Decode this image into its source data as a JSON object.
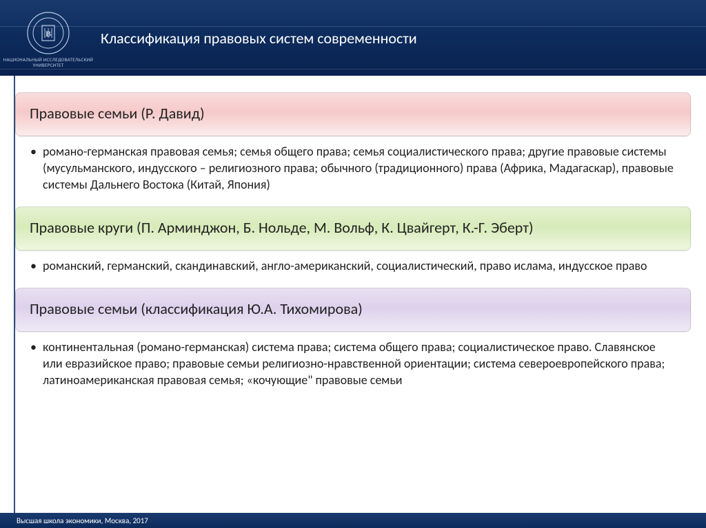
{
  "header": {
    "title": "Классификация правовых систем современности",
    "logo_line1": "НАЦИОНАЛЬНЫЙ ИССЛЕДОВАТЕЛЬСКИЙ",
    "logo_line2": "УНИВЕРСИТЕТ"
  },
  "blocks": [
    {
      "heading": "Правовые семьи (Р. Давид)",
      "body": "романо-германская правовая семья; семья общего права; семья социалистического права; другие правовые системы (мусульманского, индусского – религиозного права; обычного (традиционного) права (Африка, Мадагаскар), правовые системы Дальнего Востока (Китай, Япония)"
    },
    {
      "heading": "Правовые круги (П. Арминджон, Б. Нольде, М. Вольф, К. Цвайгерт, К.-Г. Эберт)",
      "body": "романский, германский, скандинавский, англо-американский, социалистический, право ислама, индусское право"
    },
    {
      "heading": "Правовые семьи (классификация Ю.А. Тихомирова)",
      "body": "континентальная (романо-германская) система права; система общего права; социалистическое право. Славянское или евразийское право; правовые семьи религиозно-нравственной ориентации; система североевропейского права; латиноамериканская правовая семья; «кочующие\" правовые семьи"
    }
  ],
  "footer": "Высшая школа экономики, Москва, 2017",
  "colors": {
    "header_bg": "#0c2b5c",
    "pink": "#f6c9c9",
    "green": "#d7ebb9",
    "purple": "#ddd1ec"
  }
}
